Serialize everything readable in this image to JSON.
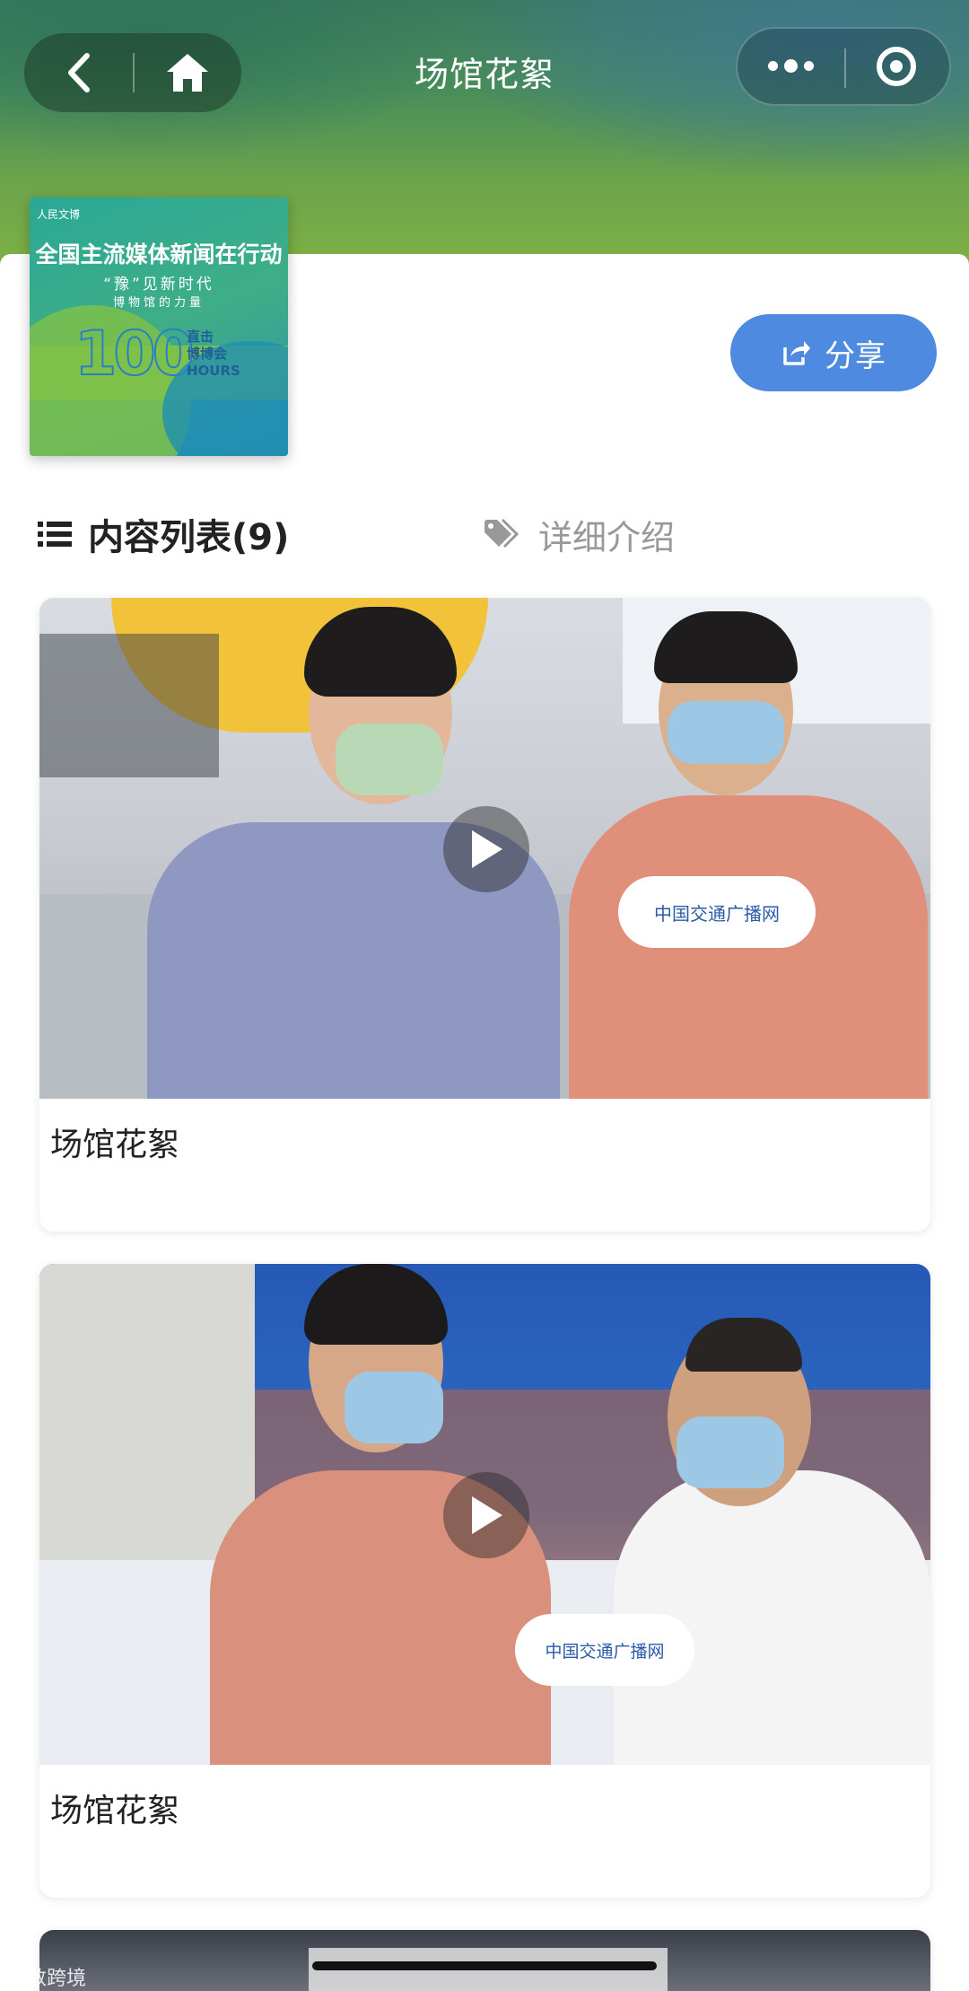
{
  "header": {
    "title": "场馆花絮",
    "back_icon": "chevron-left-icon",
    "home_icon": "home-icon",
    "more_icon": "more-dots-icon",
    "close_icon": "target-circle-icon"
  },
  "album": {
    "cover": {
      "logo_text": "人民文博",
      "title": "全国主流媒体新闻在行动",
      "subtitle1": "“豫”见新时代",
      "subtitle2": "博物馆的力量",
      "number": "100",
      "side_line1": "直击",
      "side_line2": "博博会",
      "side_line3": "HOURS"
    },
    "share_label": "分享"
  },
  "tabs": {
    "content_list": "内容列表(9)",
    "details": "详细介绍"
  },
  "videos": [
    {
      "title": "场馆花絮",
      "microphone_text": "中国交通广播网"
    },
    {
      "title": "场馆花絮",
      "microphone_text": "中国交通广播网"
    }
  ],
  "watermark": "大数跨境",
  "colors": {
    "accent": "#4d8ae0",
    "header_green": "#6ea54b"
  }
}
